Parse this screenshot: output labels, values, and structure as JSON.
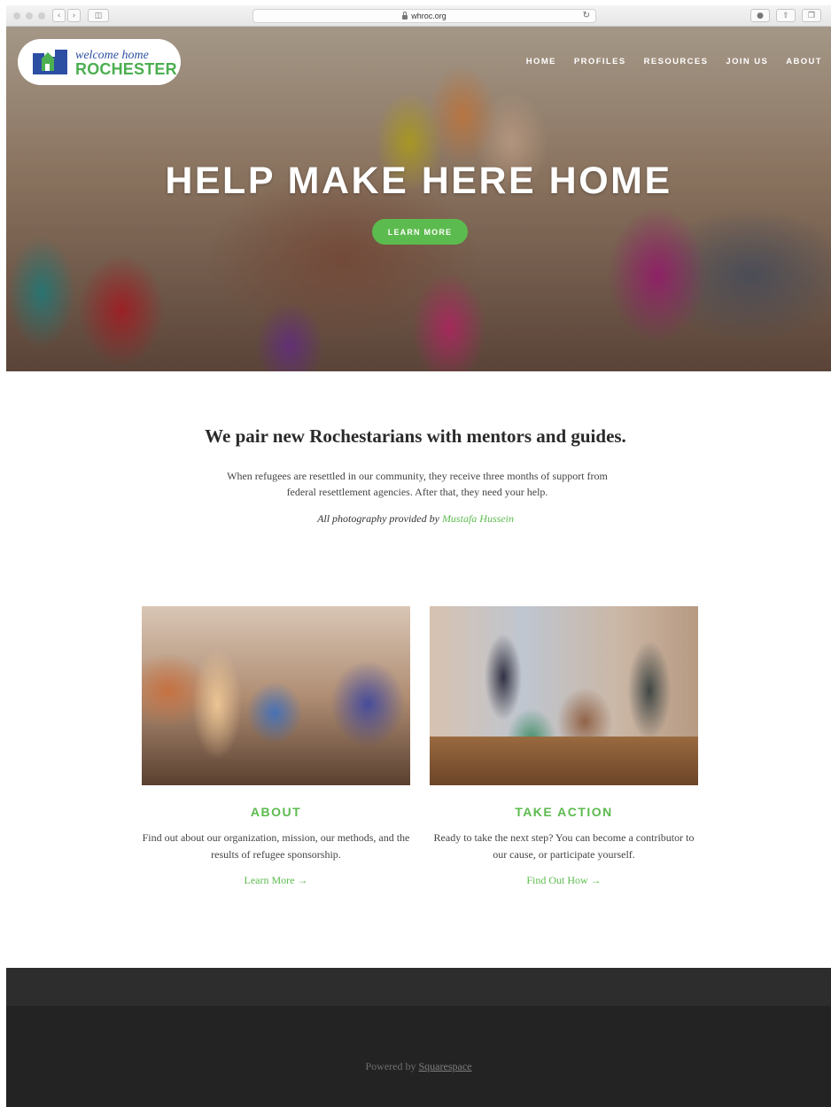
{
  "browser": {
    "url": "whroc.org"
  },
  "header": {
    "logo_top": "welcome home",
    "logo_bottom": "ROCHESTER",
    "nav": [
      "HOME",
      "PROFILES",
      "RESOURCES",
      "JOIN US",
      "ABOUT"
    ]
  },
  "hero": {
    "title": "HELP MAKE HERE HOME",
    "button": "LEARN MORE"
  },
  "intro": {
    "heading": "We pair new Rochestarians with mentors and guides.",
    "body": "When refugees are resettled in our community, they receive three months of support from federal resettlement agencies. After that, they need your help.",
    "credit_prefix": "All photography provided by ",
    "credit_name": "Mustafa Hussein"
  },
  "cards": [
    {
      "title": "ABOUT",
      "body": "Find out about our organization, mission, our methods, and the results of refugee sponsorship.",
      "link": "Learn More →"
    },
    {
      "title": "TAKE ACTION",
      "body": "Ready to take the next step? You can become a contributor to our cause, or participate yourself.",
      "link": "Find Out How →"
    }
  ],
  "footer": {
    "powered_prefix": "Powered by ",
    "powered_link": "Squarespace"
  },
  "colors": {
    "accent": "#5cbb4e",
    "logo_blue": "#2c4fa3",
    "footer_dark": "#232323"
  }
}
